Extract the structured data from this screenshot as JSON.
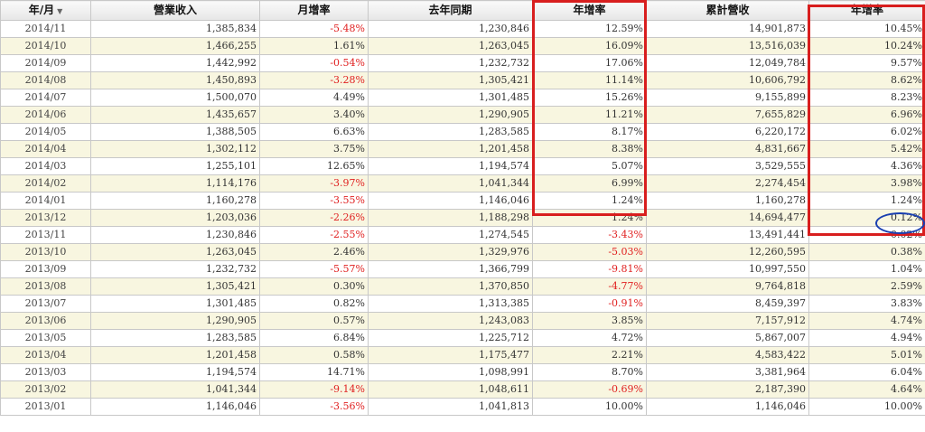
{
  "headers": {
    "year_month": "年/月",
    "revenue": "營業收入",
    "mom": "月增率",
    "last_year": "去年同期",
    "yoy": "年增率",
    "cumulative": "累計營收",
    "cum_yoy": "年增率"
  },
  "rows": [
    {
      "ym": "2014/11",
      "rev": "1,385,834",
      "mom": "-5.48%",
      "ly": "1,230,846",
      "yoy": "12.59%",
      "cum": "14,901,873",
      "cyoy": "10.45%"
    },
    {
      "ym": "2014/10",
      "rev": "1,466,255",
      "mom": "1.61%",
      "ly": "1,263,045",
      "yoy": "16.09%",
      "cum": "13,516,039",
      "cyoy": "10.24%"
    },
    {
      "ym": "2014/09",
      "rev": "1,442,992",
      "mom": "-0.54%",
      "ly": "1,232,732",
      "yoy": "17.06%",
      "cum": "12,049,784",
      "cyoy": "9.57%"
    },
    {
      "ym": "2014/08",
      "rev": "1,450,893",
      "mom": "-3.28%",
      "ly": "1,305,421",
      "yoy": "11.14%",
      "cum": "10,606,792",
      "cyoy": "8.62%"
    },
    {
      "ym": "2014/07",
      "rev": "1,500,070",
      "mom": "4.49%",
      "ly": "1,301,485",
      "yoy": "15.26%",
      "cum": "9,155,899",
      "cyoy": "8.23%"
    },
    {
      "ym": "2014/06",
      "rev": "1,435,657",
      "mom": "3.40%",
      "ly": "1,290,905",
      "yoy": "11.21%",
      "cum": "7,655,829",
      "cyoy": "6.96%"
    },
    {
      "ym": "2014/05",
      "rev": "1,388,505",
      "mom": "6.63%",
      "ly": "1,283,585",
      "yoy": "8.17%",
      "cum": "6,220,172",
      "cyoy": "6.02%"
    },
    {
      "ym": "2014/04",
      "rev": "1,302,112",
      "mom": "3.75%",
      "ly": "1,201,458",
      "yoy": "8.38%",
      "cum": "4,831,667",
      "cyoy": "5.42%"
    },
    {
      "ym": "2014/03",
      "rev": "1,255,101",
      "mom": "12.65%",
      "ly": "1,194,574",
      "yoy": "5.07%",
      "cum": "3,529,555",
      "cyoy": "4.36%"
    },
    {
      "ym": "2014/02",
      "rev": "1,114,176",
      "mom": "-3.97%",
      "ly": "1,041,344",
      "yoy": "6.99%",
      "cum": "2,274,454",
      "cyoy": "3.98%"
    },
    {
      "ym": "2014/01",
      "rev": "1,160,278",
      "mom": "-3.55%",
      "ly": "1,146,046",
      "yoy": "1.24%",
      "cum": "1,160,278",
      "cyoy": "1.24%"
    },
    {
      "ym": "2013/12",
      "rev": "1,203,036",
      "mom": "-2.26%",
      "ly": "1,188,298",
      "yoy": "1.24%",
      "cum": "14,694,477",
      "cyoy": "0.12%"
    },
    {
      "ym": "2013/11",
      "rev": "1,230,846",
      "mom": "-2.55%",
      "ly": "1,274,545",
      "yoy": "-3.43%",
      "cum": "13,491,441",
      "cyoy": "0.02%"
    },
    {
      "ym": "2013/10",
      "rev": "1,263,045",
      "mom": "2.46%",
      "ly": "1,329,976",
      "yoy": "-5.03%",
      "cum": "12,260,595",
      "cyoy": "0.38%"
    },
    {
      "ym": "2013/09",
      "rev": "1,232,732",
      "mom": "-5.57%",
      "ly": "1,366,799",
      "yoy": "-9.81%",
      "cum": "10,997,550",
      "cyoy": "1.04%"
    },
    {
      "ym": "2013/08",
      "rev": "1,305,421",
      "mom": "0.30%",
      "ly": "1,370,850",
      "yoy": "-4.77%",
      "cum": "9,764,818",
      "cyoy": "2.59%"
    },
    {
      "ym": "2013/07",
      "rev": "1,301,485",
      "mom": "0.82%",
      "ly": "1,313,385",
      "yoy": "-0.91%",
      "cum": "8,459,397",
      "cyoy": "3.83%"
    },
    {
      "ym": "2013/06",
      "rev": "1,290,905",
      "mom": "0.57%",
      "ly": "1,243,083",
      "yoy": "3.85%",
      "cum": "7,157,912",
      "cyoy": "4.74%"
    },
    {
      "ym": "2013/05",
      "rev": "1,283,585",
      "mom": "6.84%",
      "ly": "1,225,712",
      "yoy": "4.72%",
      "cum": "5,867,007",
      "cyoy": "4.94%"
    },
    {
      "ym": "2013/04",
      "rev": "1,201,458",
      "mom": "0.58%",
      "ly": "1,175,477",
      "yoy": "2.21%",
      "cum": "4,583,422",
      "cyoy": "5.01%"
    },
    {
      "ym": "2013/03",
      "rev": "1,194,574",
      "mom": "14.71%",
      "ly": "1,098,991",
      "yoy": "8.70%",
      "cum": "3,381,964",
      "cyoy": "6.04%"
    },
    {
      "ym": "2013/02",
      "rev": "1,041,344",
      "mom": "-9.14%",
      "ly": "1,048,611",
      "yoy": "-0.69%",
      "cum": "2,187,390",
      "cyoy": "4.64%"
    },
    {
      "ym": "2013/01",
      "rev": "1,146,046",
      "mom": "-3.56%",
      "ly": "1,041,813",
      "yoy": "10.00%",
      "cum": "1,146,046",
      "cyoy": "10.00%"
    }
  ],
  "colors": {
    "negative_text": "#e02020",
    "alt_row_bg": "#f8f6e0",
    "highlight_box": "#d81e1e",
    "highlight_oval": "#1a3fb0"
  },
  "icons": {
    "sort": "sort-down-icon"
  }
}
